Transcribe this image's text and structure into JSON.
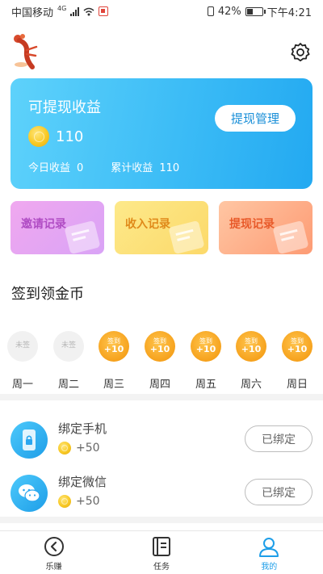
{
  "status_bar": {
    "carrier": "中国移动",
    "network": "4G",
    "battery_percent": "42%",
    "time": "下午4:21"
  },
  "header": {
    "avatar_icon": "crayfish-avatar-icon",
    "settings_icon": "gear-icon"
  },
  "earnings": {
    "title": "可提现收益",
    "balance": "110",
    "today_label": "今日收益",
    "today_value": "0",
    "total_label": "累计收益",
    "total_value": "110",
    "withdraw_button": "提现管理"
  },
  "records": [
    {
      "label": "邀请记录",
      "color": "#b04cc4"
    },
    {
      "label": "收入记录",
      "color": "#e08a1a"
    },
    {
      "label": "提现记录",
      "color": "#e85a2a"
    }
  ],
  "signin": {
    "title": "签到领金币",
    "days": [
      {
        "label": "周一",
        "state_text": "未签",
        "reward": "",
        "signed": false
      },
      {
        "label": "周二",
        "state_text": "未签",
        "reward": "",
        "signed": false
      },
      {
        "label": "周三",
        "state_text": "签到",
        "reward": "+10",
        "signed": true
      },
      {
        "label": "周四",
        "state_text": "签到",
        "reward": "+10",
        "signed": true
      },
      {
        "label": "周五",
        "state_text": "签到",
        "reward": "+10",
        "signed": true
      },
      {
        "label": "周六",
        "state_text": "签到",
        "reward": "+10",
        "signed": true
      },
      {
        "label": "周日",
        "state_text": "签到",
        "reward": "+10",
        "signed": true
      }
    ]
  },
  "tasks": [
    {
      "name": "绑定手机",
      "reward": "+50",
      "button": "已绑定",
      "icon": "phone-lock-icon"
    },
    {
      "name": "绑定微信",
      "reward": "+50",
      "button": "已绑定",
      "icon": "wechat-icon"
    }
  ],
  "nav": {
    "items": [
      {
        "label": "乐赚",
        "icon": "earn-icon"
      },
      {
        "label": "任务",
        "icon": "task-list-icon"
      },
      {
        "label": "我的",
        "icon": "profile-icon"
      }
    ],
    "active": "我的",
    "active_color": "#1e9ee8"
  }
}
